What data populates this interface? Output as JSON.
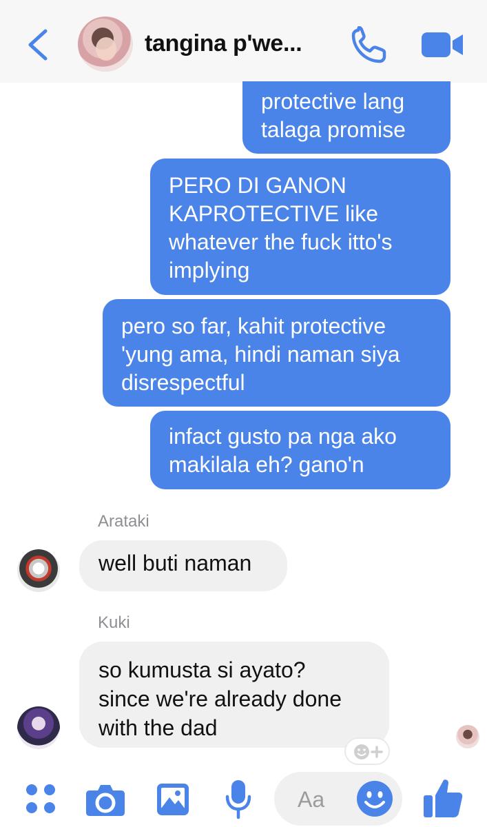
{
  "header": {
    "title": "tangina p'we...",
    "back_icon": "chevron-left-icon",
    "call_icon": "phone-icon",
    "video_icon": "video-camera-icon",
    "accent": "#4a84e8"
  },
  "messages": [
    {
      "direction": "out",
      "lines": [
        "protective lang",
        "talaga promise"
      ]
    },
    {
      "direction": "out",
      "lines": [
        "PERO DI GANON",
        "KAPROTECTIVE like",
        "whatever the fuck itto's",
        "implying"
      ]
    },
    {
      "direction": "out",
      "lines": [
        "pero so far, kahit protective",
        "'yung ama, hindi naman siya",
        "disrespectful"
      ]
    },
    {
      "direction": "out",
      "lines": [
        "infact gusto pa nga ako",
        "makilala eh? gano'n"
      ]
    },
    {
      "direction": "in",
      "sender": "Arataki",
      "lines": [
        "well buti naman"
      ]
    },
    {
      "direction": "in",
      "sender": "Kuki",
      "lines": [
        "so kumusta si ayato?",
        "since we're already done",
        "with the dad"
      ]
    }
  ],
  "composer": {
    "placeholder": "Aa",
    "icons": [
      "apps-icon",
      "camera-icon",
      "gallery-icon",
      "microphone-icon",
      "emoji-icon",
      "thumbs-up-icon"
    ]
  },
  "colors": {
    "outgoing_bubble": "#4a84e8",
    "incoming_bubble": "#f0f0f0",
    "header_bg": "#f7f7f7"
  }
}
